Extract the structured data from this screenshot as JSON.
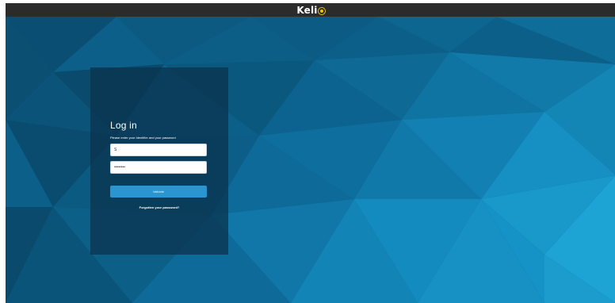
{
  "header": {
    "logo_text": "Keli"
  },
  "login": {
    "title": "Log in",
    "subtitle": "Please enter your Identifier and your password",
    "identifier_value": "S",
    "password_value": "••••••••",
    "validate_label": "Validate",
    "forgot_label": "Forgotten your password?"
  },
  "colors": {
    "topbar": "#2b2b2b",
    "logo_accent": "#f3c400",
    "background_base": "#0a5a82",
    "button": "#2a95d0"
  }
}
